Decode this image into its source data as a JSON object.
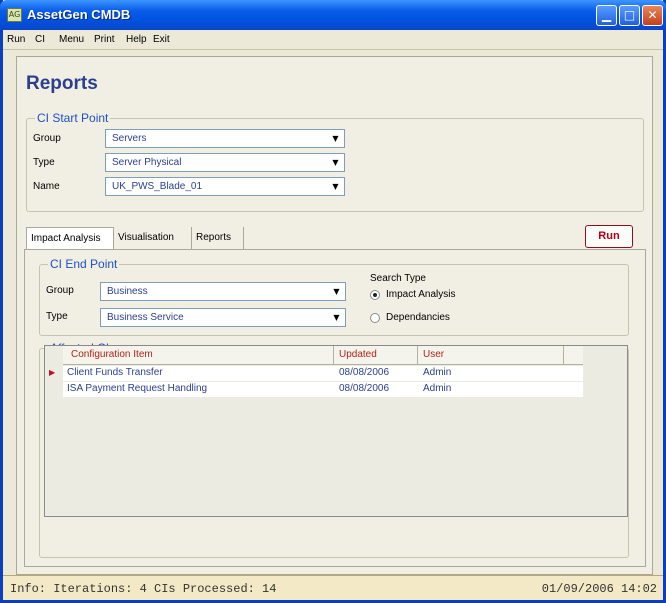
{
  "window": {
    "title": "AssetGen CMDB",
    "app_icon_text": "AG",
    "min_glyph": "▁",
    "max_glyph": "□",
    "close_glyph": "✕"
  },
  "menu": {
    "items": [
      "Run",
      "CI",
      "Menu",
      "Print",
      "Help",
      "Exit"
    ]
  },
  "page": {
    "heading": "Reports"
  },
  "start_point": {
    "legend": "CI Start Point",
    "group_label": "Group",
    "group_value": "Servers",
    "type_label": "Type",
    "type_value": "Server Physical",
    "name_label": "Name",
    "name_value": "UK_PWS_Blade_01"
  },
  "tabs": [
    "Impact Analysis",
    "Visualisation",
    "Reports"
  ],
  "run_button": "Run",
  "end_point": {
    "legend": "CI End Point",
    "group_label": "Group",
    "group_value": "Business",
    "type_label": "Type",
    "type_value": "Business Service"
  },
  "search_type": {
    "label": "Search Type",
    "options": [
      "Impact Analysis",
      "Dependancies"
    ],
    "selected": "Impact Analysis"
  },
  "affected": {
    "legend": "Affected CIs",
    "columns": [
      "Configuration Item",
      "Updated",
      "User"
    ],
    "rows": [
      {
        "item": "Client Funds Transfer",
        "updated": "08/08/2006",
        "user": "Admin"
      },
      {
        "item": "ISA Payment Request Handling",
        "updated": "08/08/2006",
        "user": "Admin"
      }
    ],
    "current_row_marker": "▶"
  },
  "status": {
    "info": "Info: Iterations: 4  CIs Processed: 14",
    "datetime": "01/09/2006 14:02"
  },
  "colors": {
    "title_bar": "#0054e3",
    "heading": "#2b3f8f",
    "legend": "#1c50c8",
    "accent_red": "#b2001a",
    "status_bg": "#f3e9c6"
  }
}
